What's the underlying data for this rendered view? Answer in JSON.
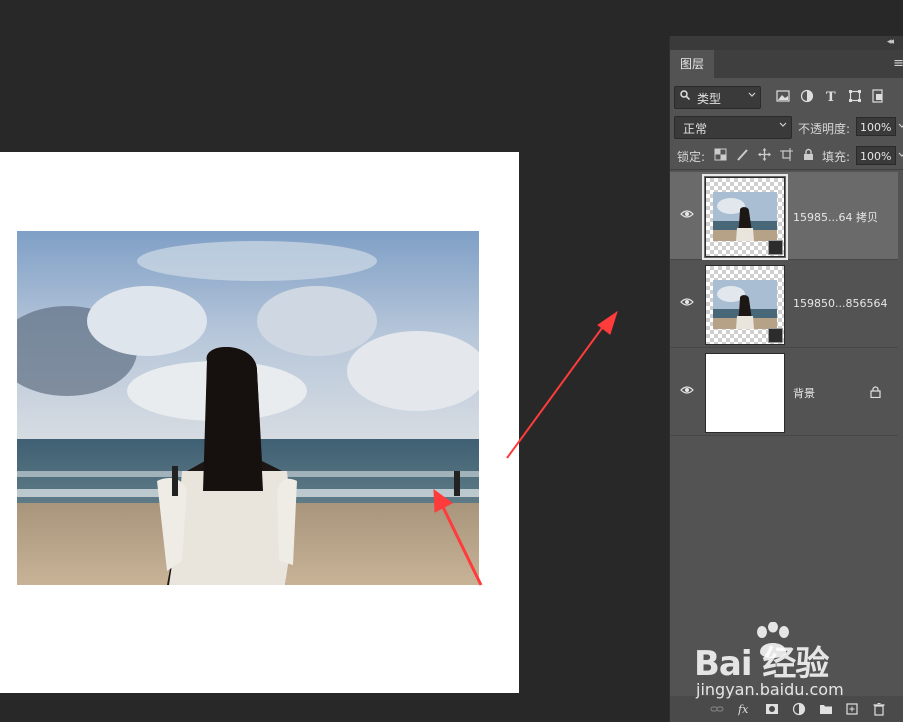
{
  "panel": {
    "tab_label": "图层",
    "filter": {
      "label": "类型"
    },
    "blend_mode": "正常",
    "opacity_label": "不透明度:",
    "opacity_value": "100%",
    "lock_label": "锁定:",
    "fill_label": "填充:",
    "fill_value": "100%",
    "layers": [
      {
        "name": "15985...64 拷贝",
        "visible": true,
        "selected": true,
        "type": "smart-object"
      },
      {
        "name": "159850...856564",
        "visible": true,
        "selected": false,
        "type": "smart-object"
      },
      {
        "name": "背景",
        "visible": true,
        "selected": false,
        "type": "background",
        "locked": true
      }
    ]
  },
  "watermark": {
    "brand": "Bai 经验",
    "url": "jingyan.baidu.com"
  },
  "colors": {
    "workspace": "#282828",
    "panel": "#535353",
    "selected_layer": "#6a6a6a",
    "arrow": "#ff3b3b"
  }
}
